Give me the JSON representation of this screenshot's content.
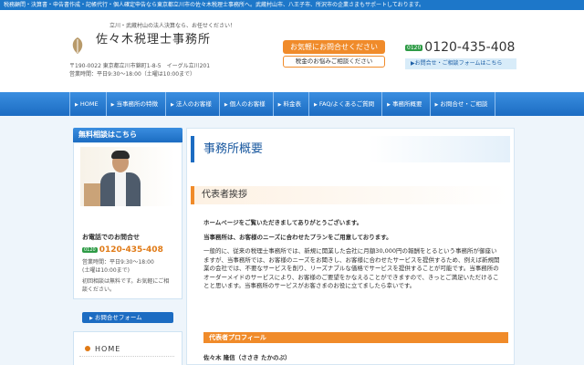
{
  "topbar": {
    "text": "税務顧問・決算書・申告書作成・記帳代行・個人確定申告なら東京都立川市の佐々木税理士事務所へ。武蔵村山市、八王子市、所沢市の企業さまもサポートしております。"
  },
  "header": {
    "tagline": "立川・武蔵村山の法人決算なら、お任せください！",
    "office_name": "佐々木税理士事務所",
    "address": "〒190-0022 東京都立川市錦町1-8-5　イーグル立川201",
    "hours": "営業時間：平日9:30～18:00（土曜は10:00まで）",
    "contact_button": "お気軽にお問合せください",
    "contact_sub": "税金のお悩みご相談ください",
    "phone_badge": "0120",
    "phone": "0120-435-408",
    "form_link": "▶お問合せ・ご相談フォームはこちら",
    "colors": {
      "accent_blue": "#1c6cc2",
      "accent_orange": "#f08b2a",
      "phone_green": "#2e9b46"
    }
  },
  "nav": {
    "items": [
      "HOME",
      "当事務所の特徴",
      "法人のお客様",
      "個人のお客様",
      "料金表",
      "FAQ/よくあるご質問",
      "事務所概要",
      "お問合せ・ご相談"
    ]
  },
  "sidebar": {
    "title": "無料相談はこちら",
    "tel_label": "お電話でのお問合せ",
    "phone_badge": "0120",
    "phone": "0120-435-408",
    "hours_1": "営業時間：平日9:30～18:00",
    "hours_2": "(土曜は10:00まで)",
    "note": "初回相談は無料です。お気軽にご相談ください。",
    "form_button": "お問合せフォーム",
    "menu_home": "HOME"
  },
  "main": {
    "page_title": "事務所概要",
    "section_title": "代表者挨拶",
    "greeting_1": "ホームページをご覧いただきましてありがとうございます。",
    "greeting_2": "当事務所は、お客様のニーズに合わせたプランをご用意しております。",
    "body": "一般的に、従来の税理士事務所では、新規に開業した会社に月額30,000円の報酬をとるという事務所が御座いますが、当事務所では、お客様のニーズをお聞きし、お客様に合わせたサービスを提供するため、例えば新規開業の会社では、不要なサービスを削り、リーズナブルな価格でサービスを提供することが可能です。当事務所のオーダーメイドのサービスにより、お客様のご要望をかなえることができますので、きっとご満足いただけることと思います。当事務所のサービスがお客さまのお役に立てましたら幸いです。",
    "profile_title": "代表者プロフィール",
    "rep_name": "佐々木 隆信（ささき たかのぶ）"
  }
}
